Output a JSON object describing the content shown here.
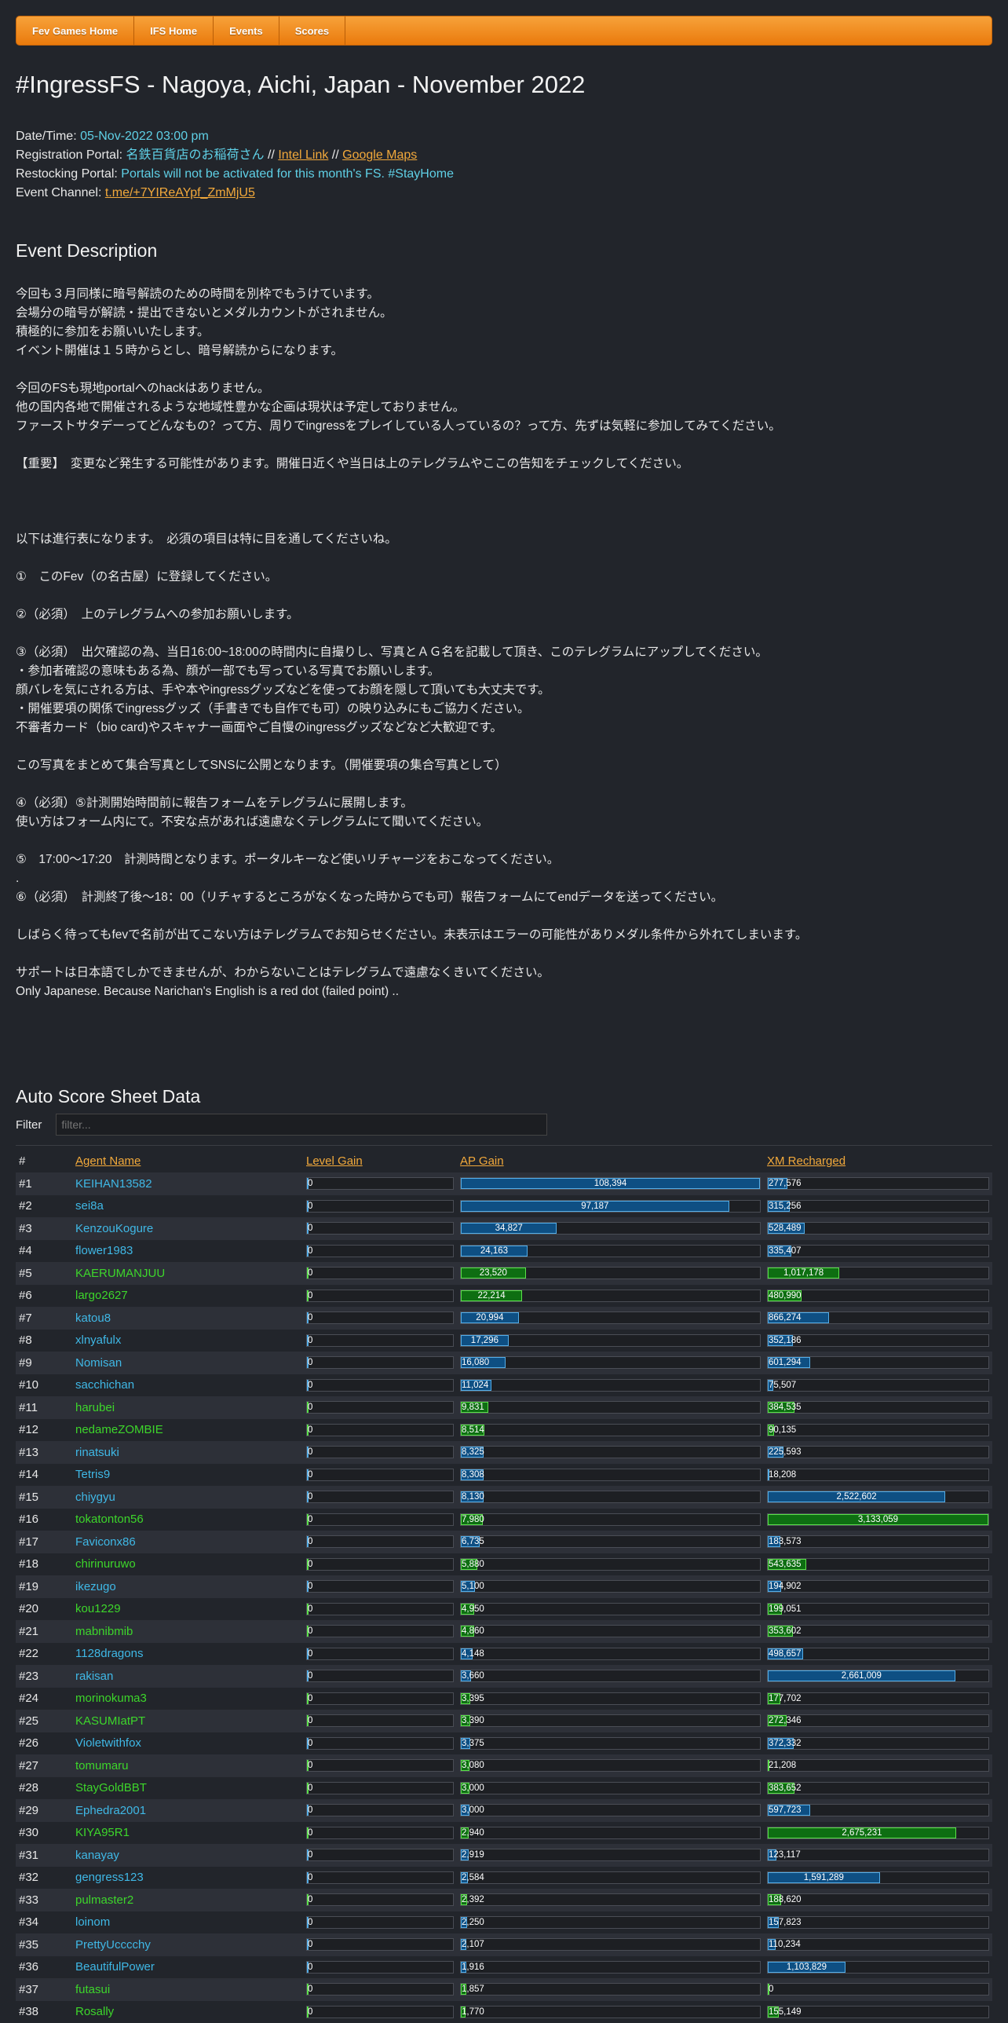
{
  "nav": [
    "Fev Games Home",
    "IFS Home",
    "Events",
    "Scores"
  ],
  "title": "#IngressFS - Nagoya, Aichi, Japan - November 2022",
  "info": {
    "datetime_label": "Date/Time:",
    "datetime": "05-Nov-2022 03:00 pm",
    "reg_label": "Registration Portal:",
    "reg_portal": "名鉄百貨店のお稲荷さん",
    "sep": " // ",
    "intel_link": "Intel Link",
    "maps_link": "Google Maps",
    "restock_label": "Restocking Portal:",
    "restock_text": "Portals will not be activated for this month's FS. #StayHome",
    "channel_label": "Event Channel:",
    "channel": "t.me/+7YIReAYpf_ZmMjU5"
  },
  "description_heading": "Event Description",
  "description": "今回も３月同様に暗号解読のための時間を別枠でもうけています。\n会場分の暗号が解読・提出できないとメダルカウントがされません。\n積極的に参加をお願いいたします。\nイベント開催は１５時からとし、暗号解読からになります。\n\n今回のFSも現地portalへのhackはありません。\n他の国内各地で開催されるような地域性豊かな企画は現状は予定しておりません。\nファーストサタデーってどんなもの？って方、周りでingressをプレイしている人っているの？って方、先ずは気軽に参加してみてください。\n\n【重要】　変更など発生する可能性があります。開催日近くや当日は上のテレグラムやここの告知をチェックしてください。\n\n\n\n以下は進行表になります。　必須の項目は特に目を通してくださいね。\n\n①　このFev（の名古屋）に登録してください。\n\n②（必須）　上のテレグラムへの参加お願いします。\n\n③（必須）　出欠確認の為、当日16:00~18:00の時間内に自撮りし、写真とＡＧ名を記載して頂き、このテレグラムにアップしてください。\n・参加者確認の意味もある為、顔が一部でも写っている写真でお願いします。\n顔バレを気にされる方は、手や本やingressグッズなどを使ってお顔を隠して頂いても大丈夫です。\n・開催要項の関係でingressグッズ（手書きでも自作でも可）の映り込みにもご協力ください。\n不審者カード（bio card)やスキャナー画面やご自慢のingressグッズなどなど大歓迎です。\n\nこの写真をまとめて集合写真としてSNSに公開となります。（開催要項の集合写真として）\n\n④（必須）⑤計測開始時間前に報告フォームをテレグラムに展開します。\n使い方はフォーム内にて。不安な点があれば遠慮なくテレグラムにて聞いてください。\n\n⑤　17:00～17:20　計測時間となります。ポータルキーなど使いリチャージをおこなってください。\n.\n⑥（必須）　計測終了後～18：00（リチャするところがなくなった時からでも可）報告フォームにてendデータを送ってください。\n\nしばらく待ってもfevで名前が出てこない方はテレグラムでお知らせください。未表示はエラーの可能性がありメダル条件から外れてしまいます。\n\nサポートは日本語でしかできませんが、わからないことはテレグラムで遠慮なくきいてください。\nOnly Japanese. Because Narichan's English is a red dot (failed point) ..",
  "score_heading": "Auto Score Sheet Data",
  "filter_label": "Filter",
  "filter_placeholder": "filter...",
  "columns": [
    "#",
    "Agent Name",
    "Level Gain",
    "AP Gain",
    "XM Recharged"
  ],
  "colors": {
    "blue": "#3fb8e6",
    "green": "#3dd62b",
    "accent": "#f2a93b",
    "bg": "#22252b"
  },
  "scale": {
    "ap_max": 108394,
    "xm_max": 3133059
  },
  "rows": [
    {
      "rank": "#1",
      "name": "KEIHAN13582",
      "team": "b",
      "level": "0",
      "ap": 108394,
      "ap_s": "108,394",
      "xm": 277576,
      "xm_s": "277,576"
    },
    {
      "rank": "#2",
      "name": "sei8a",
      "team": "b",
      "level": "0",
      "ap": 97187,
      "ap_s": "97,187",
      "xm": 315256,
      "xm_s": "315,256"
    },
    {
      "rank": "#3",
      "name": "KenzouKogure",
      "team": "b",
      "level": "0",
      "ap": 34827,
      "ap_s": "34,827",
      "xm": 528489,
      "xm_s": "528,489"
    },
    {
      "rank": "#4",
      "name": "flower1983",
      "team": "b",
      "level": "0",
      "ap": 24163,
      "ap_s": "24,163",
      "xm": 335407,
      "xm_s": "335,407"
    },
    {
      "rank": "#5",
      "name": "KAERUMANJUU",
      "team": "g",
      "level": "0",
      "ap": 23520,
      "ap_s": "23,520",
      "xm": 1017178,
      "xm_s": "1,017,178"
    },
    {
      "rank": "#6",
      "name": "largo2627",
      "team": "g",
      "level": "0",
      "ap": 22214,
      "ap_s": "22,214",
      "xm": 480990,
      "xm_s": "480,990"
    },
    {
      "rank": "#7",
      "name": "katou8",
      "team": "b",
      "level": "0",
      "ap": 20994,
      "ap_s": "20,994",
      "xm": 866274,
      "xm_s": "866,274"
    },
    {
      "rank": "#8",
      "name": "xlnyafulx",
      "team": "b",
      "level": "0",
      "ap": 17296,
      "ap_s": "17,296",
      "xm": 352186,
      "xm_s": "352,186"
    },
    {
      "rank": "#9",
      "name": "Nomisan",
      "team": "b",
      "level": "0",
      "ap": 16080,
      "ap_s": "16,080",
      "xm": 601294,
      "xm_s": "601,294"
    },
    {
      "rank": "#10",
      "name": "sacchichan",
      "team": "b",
      "level": "0",
      "ap": 11024,
      "ap_s": "11,024",
      "xm": 75507,
      "xm_s": "75,507"
    },
    {
      "rank": "#11",
      "name": "harubei",
      "team": "g",
      "level": "0",
      "ap": 9831,
      "ap_s": "9,831",
      "xm": 384535,
      "xm_s": "384,535"
    },
    {
      "rank": "#12",
      "name": "nedameZOMBIE",
      "team": "g",
      "level": "0",
      "ap": 8514,
      "ap_s": "8,514",
      "xm": 90135,
      "xm_s": "90,135"
    },
    {
      "rank": "#13",
      "name": "rinatsuki",
      "team": "b",
      "level": "0",
      "ap": 8325,
      "ap_s": "8,325",
      "xm": 225593,
      "xm_s": "225,593"
    },
    {
      "rank": "#14",
      "name": "Tetris9",
      "team": "b",
      "level": "0",
      "ap": 8308,
      "ap_s": "8,308",
      "xm": 18208,
      "xm_s": "18,208"
    },
    {
      "rank": "#15",
      "name": "chiygyu",
      "team": "b",
      "level": "0",
      "ap": 8130,
      "ap_s": "8,130",
      "xm": 2522602,
      "xm_s": "2,522,602"
    },
    {
      "rank": "#16",
      "name": "tokatonton56",
      "team": "g",
      "level": "0",
      "ap": 7980,
      "ap_s": "7,980",
      "xm": 3133059,
      "xm_s": "3,133,059"
    },
    {
      "rank": "#17",
      "name": "Faviconx86",
      "team": "b",
      "level": "0",
      "ap": 6735,
      "ap_s": "6,735",
      "xm": 183573,
      "xm_s": "183,573"
    },
    {
      "rank": "#18",
      "name": "chirinuruwo",
      "team": "g",
      "level": "0",
      "ap": 5880,
      "ap_s": "5,880",
      "xm": 543635,
      "xm_s": "543,635"
    },
    {
      "rank": "#19",
      "name": "ikezugo",
      "team": "b",
      "level": "0",
      "ap": 5100,
      "ap_s": "5,100",
      "xm": 194902,
      "xm_s": "194,902"
    },
    {
      "rank": "#20",
      "name": "kou1229",
      "team": "g",
      "level": "0",
      "ap": 4950,
      "ap_s": "4,950",
      "xm": 199051,
      "xm_s": "199,051"
    },
    {
      "rank": "#21",
      "name": "mabnibmib",
      "team": "g",
      "level": "0",
      "ap": 4860,
      "ap_s": "4,860",
      "xm": 353602,
      "xm_s": "353,602"
    },
    {
      "rank": "#22",
      "name": "1128dragons",
      "team": "b",
      "level": "0",
      "ap": 4148,
      "ap_s": "4,148",
      "xm": 498657,
      "xm_s": "498,657"
    },
    {
      "rank": "#23",
      "name": "rakisan",
      "team": "b",
      "level": "0",
      "ap": 3660,
      "ap_s": "3,660",
      "xm": 2661009,
      "xm_s": "2,661,009"
    },
    {
      "rank": "#24",
      "name": "morinokuma3",
      "team": "g",
      "level": "0",
      "ap": 3395,
      "ap_s": "3,395",
      "xm": 177702,
      "xm_s": "177,702"
    },
    {
      "rank": "#25",
      "name": "KASUMIatPT",
      "team": "g",
      "level": "0",
      "ap": 3390,
      "ap_s": "3,390",
      "xm": 272346,
      "xm_s": "272,346"
    },
    {
      "rank": "#26",
      "name": "Violetwithfox",
      "team": "b",
      "level": "0",
      "ap": 3375,
      "ap_s": "3,375",
      "xm": 372332,
      "xm_s": "372,332"
    },
    {
      "rank": "#27",
      "name": "tomumaru",
      "team": "g",
      "level": "0",
      "ap": 3080,
      "ap_s": "3,080",
      "xm": 21208,
      "xm_s": "21,208"
    },
    {
      "rank": "#28",
      "name": "StayGoldBBT",
      "team": "g",
      "level": "0",
      "ap": 3000,
      "ap_s": "3,000",
      "xm": 383652,
      "xm_s": "383,652"
    },
    {
      "rank": "#29",
      "name": "Ephedra2001",
      "team": "b",
      "level": "0",
      "ap": 3000,
      "ap_s": "3,000",
      "xm": 597723,
      "xm_s": "597,723"
    },
    {
      "rank": "#30",
      "name": "KIYA95R1",
      "team": "g",
      "level": "0",
      "ap": 2940,
      "ap_s": "2,940",
      "xm": 2675231,
      "xm_s": "2,675,231"
    },
    {
      "rank": "#31",
      "name": "kanayay",
      "team": "b",
      "level": "0",
      "ap": 2919,
      "ap_s": "2,919",
      "xm": 123117,
      "xm_s": "123,117"
    },
    {
      "rank": "#32",
      "name": "gengress123",
      "team": "b",
      "level": "0",
      "ap": 2584,
      "ap_s": "2,584",
      "xm": 1591289,
      "xm_s": "1,591,289"
    },
    {
      "rank": "#33",
      "name": "pulmaster2",
      "team": "g",
      "level": "0",
      "ap": 2392,
      "ap_s": "2,392",
      "xm": 188620,
      "xm_s": "188,620"
    },
    {
      "rank": "#34",
      "name": "loinom",
      "team": "b",
      "level": "0",
      "ap": 2250,
      "ap_s": "2,250",
      "xm": 157823,
      "xm_s": "157,823"
    },
    {
      "rank": "#35",
      "name": "PrettyUcccchy",
      "team": "b",
      "level": "0",
      "ap": 2107,
      "ap_s": "2,107",
      "xm": 110234,
      "xm_s": "110,234"
    },
    {
      "rank": "#36",
      "name": "BeautifulPower",
      "team": "b",
      "level": "0",
      "ap": 1916,
      "ap_s": "1,916",
      "xm": 1103829,
      "xm_s": "1,103,829"
    },
    {
      "rank": "#37",
      "name": "futasui",
      "team": "g",
      "level": "0",
      "ap": 1857,
      "ap_s": "1,857",
      "xm": 0,
      "xm_s": "0"
    },
    {
      "rank": "#38",
      "name": "Rosally",
      "team": "g",
      "level": "0",
      "ap": 1770,
      "ap_s": "1,770",
      "xm": 155149,
      "xm_s": "155,149"
    }
  ]
}
